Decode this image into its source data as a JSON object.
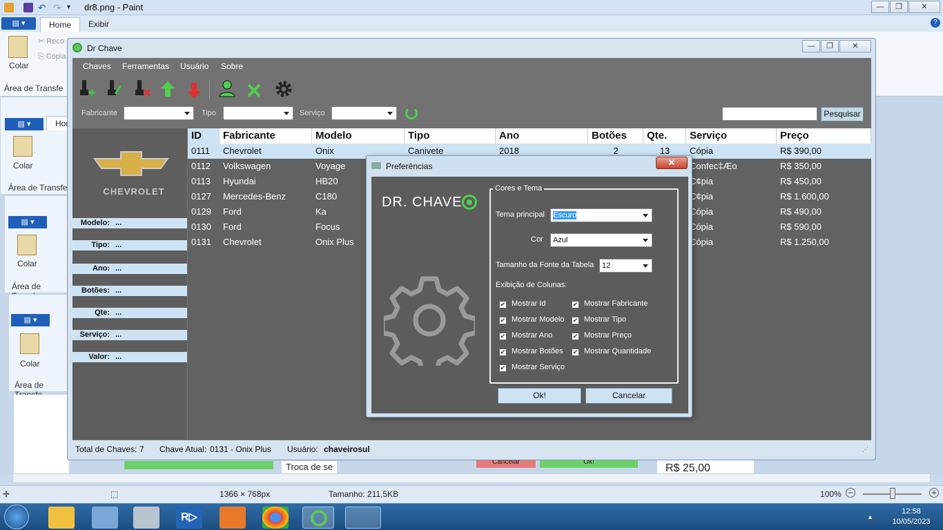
{
  "paint": {
    "window_title": "dr8.png - Paint",
    "tabs": [
      "Home",
      "Exibir"
    ],
    "ghost_tab": "Hom",
    "colar_label": "Colar",
    "recortar_label": "Reco",
    "copiar_label": "Copia",
    "area_label": "Área de Transfe",
    "status": {
      "dimensions": "1366 × 768px",
      "size": "Tamanho: 211,5KB",
      "zoom": "100%"
    },
    "bg_text_1": "Troca de se",
    "bg_text_2": "R$ 25,00",
    "bg_btn_1": "Cancelar",
    "bg_btn_2": "Ok!"
  },
  "taskbar": {
    "time": "12:58",
    "date": "10/05/2023"
  },
  "drchave": {
    "title": "Dr Chave",
    "menu": [
      "Chaves",
      "Ferramentas",
      "Usuário",
      "Sobre"
    ],
    "filters": {
      "fabricante_label": "Fabricante",
      "tipo_label": "Tipo",
      "servico_label": "Serviço",
      "search_button": "Pesquisar"
    },
    "brand": "CHEVROLET",
    "fields": [
      {
        "label": "Modelo:",
        "value": "..."
      },
      {
        "label": "Tipo:",
        "value": "..."
      },
      {
        "label": "Ano:",
        "value": "..."
      },
      {
        "label": "Botões:",
        "value": "..."
      },
      {
        "label": "Qte:",
        "value": "..."
      },
      {
        "label": "Serviço:",
        "value": "..."
      },
      {
        "label": "Valor:",
        "value": "..."
      }
    ],
    "table": {
      "headers": [
        "ID",
        "Fabricante",
        "Modelo",
        "Tipo",
        "Ano",
        "Botões",
        "Qte.",
        "Serviço",
        "Preço"
      ],
      "rows": [
        [
          "0111",
          "Chevrolet",
          "Onix",
          "Canivete",
          "2018",
          "2",
          "13",
          "Cópia",
          "R$ 390,00"
        ],
        [
          "0112",
          "Volkswagen",
          "Voyage",
          "",
          "",
          "",
          "",
          "Confec‡Æo",
          "R$ 350,00"
        ],
        [
          "0113",
          "Hyundai",
          "HB20",
          "",
          "",
          "",
          "",
          "C¢pia",
          "R$ 450,00"
        ],
        [
          "0127",
          "Mercedes-Benz",
          "C180",
          "",
          "",
          "",
          "",
          "C¢pia",
          "R$ 1.600,00"
        ],
        [
          "0129",
          "Ford",
          "Ka",
          "",
          "",
          "",
          "",
          "Cópia",
          "R$ 490,00"
        ],
        [
          "0130",
          "Ford",
          "Focus",
          "",
          "",
          "",
          "",
          "Cópia",
          "R$ 590,00"
        ],
        [
          "0131",
          "Chevrolet",
          "Onix Plus",
          "",
          "",
          "",
          "",
          "Cópia",
          "R$ 1.250,00"
        ]
      ]
    },
    "statusbar": {
      "total_label": "Total de Chaves:",
      "total_value": "7",
      "atual_label": "Chave Atual:",
      "atual_value": "0131 - Onix Plus",
      "usuario_label": "Usuário:",
      "usuario_value": "chaveirosul"
    }
  },
  "prefs": {
    "title": "Preferências",
    "logo_text": "DR. CHAVE",
    "group_title": "Cores e Tema",
    "tema_label": "Tema principal",
    "tema_value": "Escuro",
    "cor_label": "Cor",
    "cor_value": "Azul",
    "fonte_label": "Tamanho da Fonte da Tabela",
    "fonte_value": "12",
    "colunas_label": "Exibição de Colunas:",
    "checkboxes": [
      {
        "label": "Mostrar Id",
        "checked": true
      },
      {
        "label": "Mostrar Fabricante",
        "checked": true
      },
      {
        "label": "Mostrar Modelo",
        "checked": true
      },
      {
        "label": "Mostrar Tipo",
        "checked": true
      },
      {
        "label": "Mostrar Ano",
        "checked": true
      },
      {
        "label": "Mostrar Preço",
        "checked": true
      },
      {
        "label": "Mostrar Botões",
        "checked": true
      },
      {
        "label": "Mostrar Quantidade",
        "checked": true
      },
      {
        "label": "Mostrar Serviço",
        "checked": true
      }
    ],
    "ok_button": "Ok!",
    "cancel_button": "Cancelar"
  },
  "colors": {
    "dark_bg": "#727272",
    "accent_light": "#cde3f3",
    "logo_green": "#5fc65a"
  }
}
